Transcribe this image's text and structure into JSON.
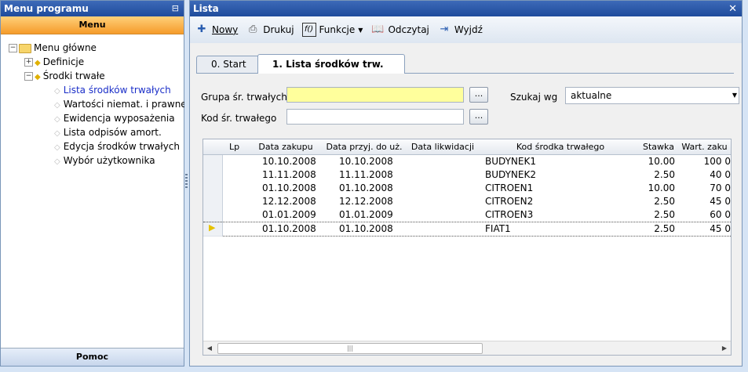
{
  "left": {
    "title": "Menu programu",
    "pin_glyph": "📌",
    "menu_band": "Menu",
    "tree": [
      {
        "label": "Menu główne",
        "level": 0,
        "kind": "folder",
        "exp": "−"
      },
      {
        "label": "Definicje",
        "level": 1,
        "kind": "node",
        "exp": "+"
      },
      {
        "label": "Środki trwałe",
        "level": 1,
        "kind": "node",
        "exp": "−"
      },
      {
        "label": "Lista środków trwałych",
        "level": 2,
        "kind": "leaf",
        "active": true
      },
      {
        "label": "Wartości niemat. i prawne",
        "level": 2,
        "kind": "leaf"
      },
      {
        "label": "Ewidencja wyposażenia",
        "level": 2,
        "kind": "leaf"
      },
      {
        "label": "Lista odpisów amort.",
        "level": 2,
        "kind": "leaf"
      },
      {
        "label": "Edycja środków trwałych",
        "level": 2,
        "kind": "leaf"
      },
      {
        "label": "Wybór użytkownika",
        "level": 2,
        "kind": "leaf"
      }
    ],
    "footer": "Pomoc"
  },
  "right": {
    "title": "Lista",
    "close": "✕",
    "toolbar": {
      "nowy": "Nowy",
      "drukuj": "Drukuj",
      "funkcje": "Funkcje",
      "odczytaj": "Odczytaj",
      "wyjdz": "Wyjdź"
    },
    "tabs": [
      "0. Start",
      "1. Lista środków trw."
    ],
    "form": {
      "grupa_label": "Grupa śr. trwałych",
      "kod_label": "Kod śr. trwałego",
      "szukaj_label": "Szukaj wg",
      "szukaj_value": "aktualne",
      "dots": "..."
    },
    "grid": {
      "columns": [
        "Lp",
        "Data zakupu",
        "Data przyj. do uż.",
        "Data likwidacji",
        "Kod środka trwałego",
        "Stawka",
        "Wart. zaku"
      ],
      "rows": [
        [
          "",
          "10.10.2008",
          "10.10.2008",
          "",
          "BUDYNEK1",
          "10.00",
          "100 0"
        ],
        [
          "",
          "11.11.2008",
          "11.11.2008",
          "",
          "BUDYNEK2",
          "2.50",
          "40 0"
        ],
        [
          "",
          "01.10.2008",
          "01.10.2008",
          "",
          "CITROEN1",
          "10.00",
          "70 0"
        ],
        [
          "",
          "12.12.2008",
          "12.12.2008",
          "",
          "CITROEN2",
          "2.50",
          "45 0"
        ],
        [
          "",
          "01.01.2009",
          "01.01.2009",
          "",
          "CITROEN3",
          "2.50",
          "60 0"
        ],
        [
          "",
          "01.10.2008",
          "01.10.2008",
          "",
          "FIAT1",
          "2.50",
          "45 0"
        ]
      ],
      "selected_row": 5
    }
  }
}
